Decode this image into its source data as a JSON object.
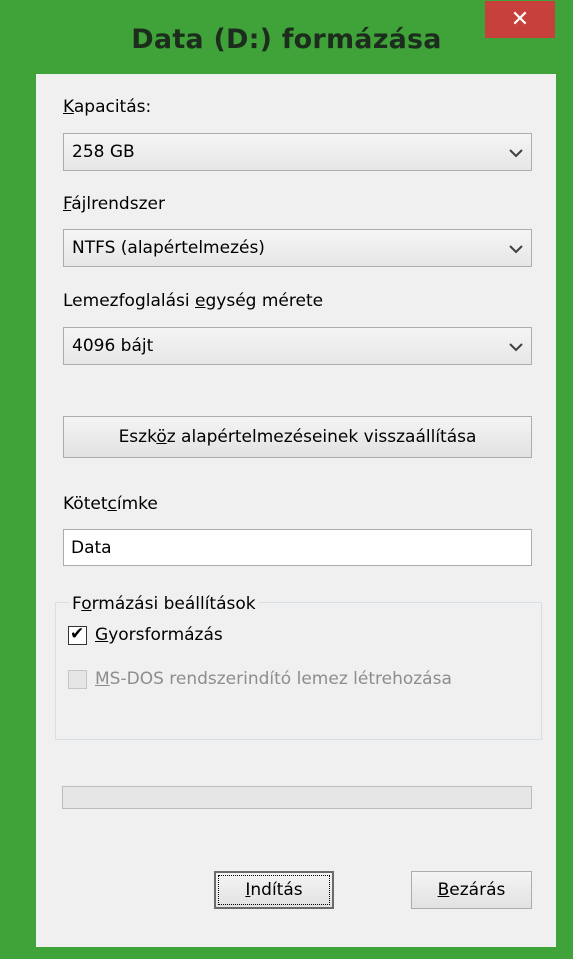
{
  "window": {
    "title": "Data (D:) formázása",
    "close_label": "✕",
    "accent_color": "#3fa33a",
    "close_color": "#c7403b"
  },
  "capacity": {
    "label_key": "K",
    "label_rest": "apacitás:",
    "value": "258 GB"
  },
  "filesystem": {
    "label_key": "F",
    "label_rest": "ájlrendszer",
    "value": "NTFS (alapértelmezés)"
  },
  "allocation": {
    "label_pre": "Lemezfoglalási ",
    "label_key": "e",
    "label_rest": "gység mérete",
    "value": "4096 bájt"
  },
  "restore_defaults": {
    "label_pre": "Eszk",
    "label_key": "ö",
    "label_rest": "z alapértelmezéseinek visszaállítása"
  },
  "volume_label": {
    "label_pre": "Kötet",
    "label_key": "c",
    "label_rest": "ímke",
    "value": "Data"
  },
  "format_options": {
    "legend_pre": "F",
    "legend_key": "o",
    "legend_rest": "rmázási beállítások",
    "quick_format": {
      "checked": true,
      "check_glyph": "✔",
      "label_key": "G",
      "label_rest": "yorsformázás"
    },
    "msdos_disk": {
      "checked": false,
      "enabled": false,
      "label_key": "M",
      "label_rest": "S-DOS rendszerindító lemez létrehozása"
    }
  },
  "progress": {
    "value": 0
  },
  "buttons": {
    "start_key": "I",
    "start_rest": "ndítás",
    "close_key": "B",
    "close_rest": "ezárás"
  }
}
